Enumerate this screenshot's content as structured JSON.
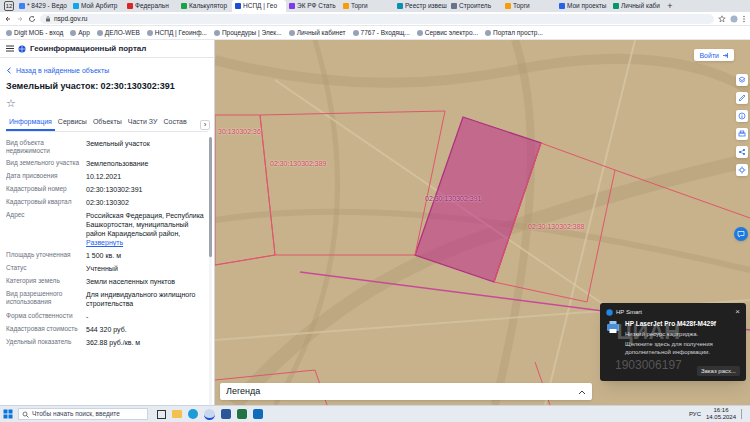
{
  "browser": {
    "tab_count": "12",
    "tabs": [
      {
        "label": "* 8429 - Ведо",
        "selected": false
      },
      {
        "label": "Мой Арбитр",
        "selected": false
      },
      {
        "label": "Федеральн",
        "selected": false
      },
      {
        "label": "Калькулятор",
        "selected": false
      },
      {
        "label": "НСПД | Гео",
        "selected": true
      },
      {
        "label": "ЭК РФ Стать",
        "selected": false
      },
      {
        "label": "Торги",
        "selected": false
      },
      {
        "label": "Реестр извеш",
        "selected": false
      },
      {
        "label": "Строитель",
        "selected": false
      },
      {
        "label": "Торги",
        "selected": false
      },
      {
        "label": "Мои проекты",
        "selected": false
      },
      {
        "label": "Личный каби",
        "selected": false
      }
    ],
    "new_tab": "+",
    "url": "nspd.gov.ru",
    "bookmarks": [
      "Digit МОБ - вход",
      "Арр",
      "ДЕЛО-WEB",
      "НСПД | Геоинф...",
      "Процедуры | Элек...",
      "Личный кабинет",
      "7767 - Входящ...",
      "Сервис электро...",
      "Портал простр..."
    ]
  },
  "app": {
    "title": "Геоинформационный портал",
    "login": "Войти"
  },
  "panel": {
    "back": "Назад в найденные объекты",
    "title": "Земельный участок: 02:30:130302:391",
    "star": "☆",
    "tabs": [
      {
        "label": "Информация",
        "selected": true
      },
      {
        "label": "Сервисы",
        "selected": false
      },
      {
        "label": "Объекты",
        "selected": false
      },
      {
        "label": "Части ЗУ",
        "selected": false
      },
      {
        "label": "Состав",
        "selected": false
      }
    ],
    "tabs_next": "›",
    "rows": [
      {
        "label": "Вид объекта недвижимости",
        "value": "Земельный участок"
      },
      {
        "label": "Вид земельного участка",
        "value": "Землепользование"
      },
      {
        "label": "Дата присвоения",
        "value": "10.12.2021"
      },
      {
        "label": "Кадастровый номер",
        "value": "02:30:130302:391"
      },
      {
        "label": "Кадастровый квартал",
        "value": "02:30:130302"
      },
      {
        "label": "Адрес",
        "value": "Российская Федерация, Республика Башкортостан, муниципальный район Караидельский район,",
        "link": "Развернуть"
      },
      {
        "label": "Площадь уточненная",
        "value": "1 500 кв. м"
      },
      {
        "label": "Статус",
        "value": "Учтенный"
      },
      {
        "label": "Категория земель",
        "value": "Земли населенных пунктов"
      },
      {
        "label": "Вид разрешенного использования",
        "value": "Для индивидуального жилищного строительства"
      },
      {
        "label": "Форма собственности",
        "value": "-"
      },
      {
        "label": "Кадастровая стоимость",
        "value": "544 320 руб."
      },
      {
        "label": "Удельный показатель",
        "value": "362.88 руб./кв. м"
      }
    ]
  },
  "map": {
    "parcels": [
      {
        "label": "02:30:130302:391",
        "selected": true
      },
      {
        "label": "02:30:130302:389",
        "selected": false
      },
      {
        "label": "02:30:130302:388",
        "selected": false
      },
      {
        "label": "30:130302:36",
        "selected": false
      }
    ],
    "legend": "Легенда",
    "watermark": [
      "ЦИАН",
      "1903006197"
    ]
  },
  "notification": {
    "app": "HP Smart",
    "close": "×",
    "title": "HP LaserJet Pro M428f-M429f",
    "lines": [
      "Низкий ресурс картриджа.",
      "Щелкните здесь для получения дополнительной информации."
    ],
    "action": "Заказ расх..."
  },
  "taskbar": {
    "search": "Чтобы начать поиск, введите",
    "language": "РУС",
    "time": "16:16",
    "date": "14.05.2024"
  }
}
